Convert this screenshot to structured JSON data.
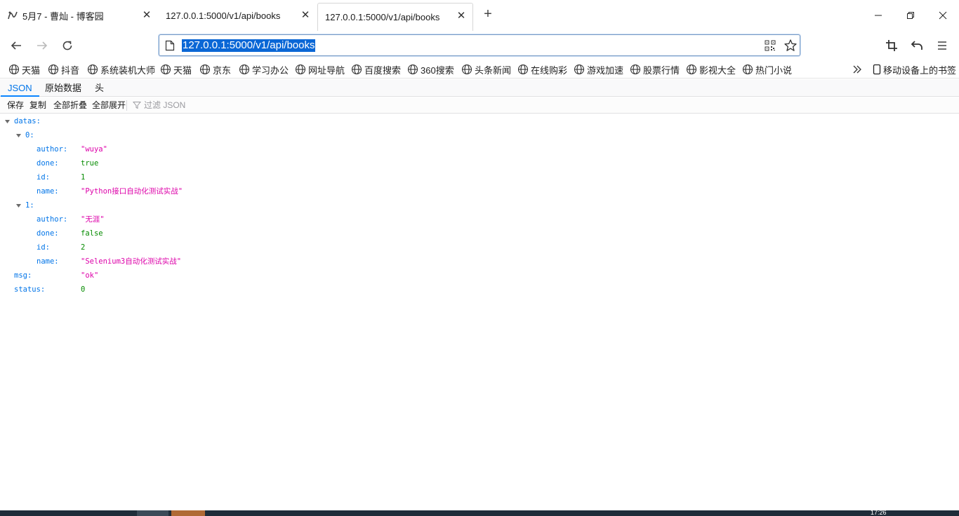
{
  "tabs": [
    {
      "label": "5月7 - 曹灿 - 博客园",
      "active": false
    },
    {
      "label": "127.0.0.1:5000/v1/api/books",
      "active": false
    },
    {
      "label": "127.0.0.1:5000/v1/api/books",
      "active": true
    }
  ],
  "address_bar": {
    "url": "127.0.0.1:5000/v1/api/books"
  },
  "bookmarks": {
    "items": [
      "天猫",
      "抖音",
      "系统装机大师",
      "天猫",
      "京东",
      "学习办公",
      "网址导航",
      "百度搜索",
      "360搜索",
      "头条新闻",
      "在线购彩",
      "游戏加速",
      "股票行情",
      "影视大全",
      "热门小说"
    ],
    "mobile": "移动设备上的书签"
  },
  "viewer": {
    "tabs": [
      "JSON",
      "原始数据",
      "头"
    ],
    "toolbar": {
      "save": "保存",
      "copy": "复制",
      "collapse_all": "全部折叠",
      "expand_all": "全部展开",
      "filter_placeholder": "过滤 JSON"
    }
  },
  "json": {
    "datas_key": "datas:",
    "items": [
      {
        "index": "0:",
        "author": "\"wuya\"",
        "done": "true",
        "id": "1",
        "name": "\"Python接口自动化测试实战\""
      },
      {
        "index": "1:",
        "author": "\"无涯\"",
        "done": "false",
        "id": "2",
        "name": "\"Selenium3自动化测试实战\""
      }
    ],
    "field_keys": {
      "author": "author:",
      "done": "done:",
      "id": "id:",
      "name": "name:"
    },
    "msg_key": "msg:",
    "msg": "\"ok\"",
    "status_key": "status:",
    "status": "0"
  },
  "taskbar": {
    "clock_partial": "17:26"
  }
}
